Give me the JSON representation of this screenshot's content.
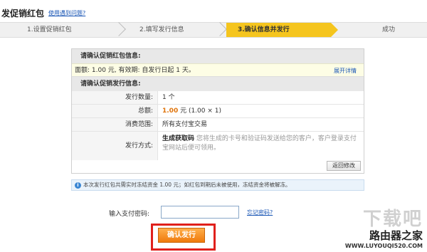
{
  "header": {
    "title": "发促销红包",
    "help_link": "使用遇到问题?"
  },
  "steps": [
    {
      "label": "1.设置促销红包"
    },
    {
      "label": "2.填写发行信息"
    },
    {
      "label": "3.确认信息并发行"
    },
    {
      "label": "成功"
    }
  ],
  "redpacket_section": {
    "heading": "请确认促销红包信息:",
    "amount_line": "面额:  1.00  元,  有效期:  自发行日起  1  天。",
    "expand_link": "展开详情"
  },
  "issue_section": {
    "heading": "请确认促销发行信息:",
    "rows": [
      {
        "label": "发行数量:",
        "value": "1 个"
      },
      {
        "label": "总额:",
        "value_main": "1.00",
        "value_rest": " 元 (1.00 × 1)"
      },
      {
        "label": "消费范围:",
        "value": "所有支付宝交易"
      },
      {
        "label": "发行方式:",
        "value_main": "生成获取码",
        "value_rest": " 您将生成的卡号和验证码发送给您的客户，客户登录支付宝网站后便可领用。"
      }
    ],
    "back_button": "返回修改"
  },
  "notice": {
    "icon": "info-icon",
    "text": "本次发行红包共需实时冻结资金 1.00 元；如红包到期后未被使用，冻结资金将被解冻。"
  },
  "password": {
    "label": "输入支付密码:",
    "value": "",
    "forgot_link": "忘记密码?"
  },
  "confirm_button": "确认发行",
  "watermark": {
    "big": "下载吧",
    "cn": "路由器之家",
    "url": "WWW.LUYOUQI520.COM"
  },
  "colors": {
    "active_step": "#f5c51e",
    "link": "#1a56b5",
    "highlight_frame": "#e0201c",
    "button": "#ef7a0c"
  }
}
